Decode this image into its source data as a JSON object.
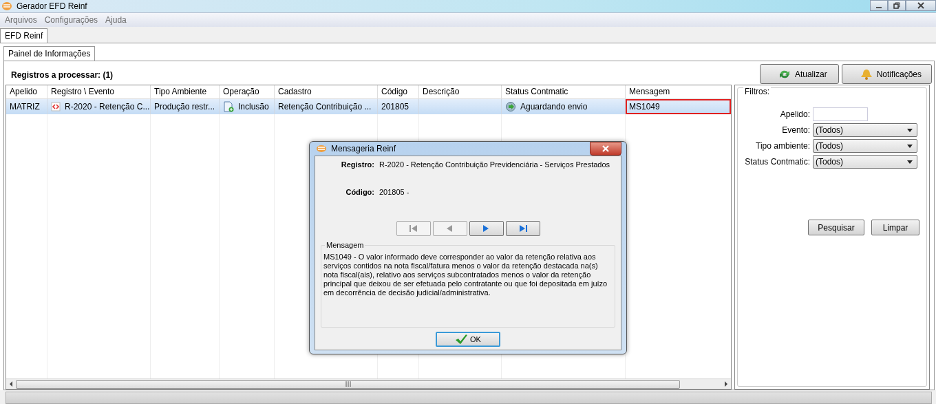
{
  "window": {
    "title": "Gerador EFD Reinf"
  },
  "menu": [
    "Arquivos",
    "Configurações",
    "Ajuda"
  ],
  "tabs": [
    {
      "label": "EFD Reinf",
      "selected": true
    }
  ],
  "subtabs": [
    {
      "label": "Painel de Informações",
      "selected": true
    }
  ],
  "summary": "Registros a processar: (1)",
  "toolbar": [
    "Atualizar",
    "Notificações"
  ],
  "table": {
    "columns": [
      "Apelido",
      "Registro \\ Evento",
      "Tipo Ambiente",
      "Operação",
      "Cadastro",
      "Código",
      "Descrição",
      "Status Contmatic",
      "Mensagem"
    ],
    "rows": [
      {
        "selected": true,
        "cells": [
          {
            "text": "MATRIZ",
            "highlighted": false
          },
          {
            "text": "R-2020 - Retenção C...",
            "highlighted": false
          },
          {
            "text": "Produção restr...",
            "highlighted": false
          },
          {
            "text": "Inclusão",
            "highlighted": false
          },
          {
            "text": "Retenção Contribuição ...",
            "highlighted": false
          },
          {
            "text": "201805",
            "highlighted": false
          },
          {
            "text": "",
            "highlighted": false
          },
          {
            "text": "Aguardando envio",
            "highlighted": false
          },
          {
            "text": "MS1049",
            "highlighted": true
          }
        ]
      }
    ]
  },
  "filters": {
    "title": "Filtros:",
    "fields": [
      {
        "kind": "text",
        "label": "Apelido:"
      },
      {
        "kind": "select",
        "label": "Evento:",
        "value": "(Todos)"
      },
      {
        "kind": "select",
        "label": "Tipo ambiente:",
        "value": "(Todos)"
      },
      {
        "kind": "select",
        "label": "Status Contmatic:",
        "value": "(Todos)"
      }
    ],
    "buttons": [
      "Pesquisar",
      "Limpar"
    ]
  },
  "dialog": {
    "title": "Mensageria Reinf",
    "fields": [
      {
        "label": "Registro:",
        "value": "R-2020 - Retenção Contribuição Previdenciária - Serviços Prestados"
      },
      {
        "label": "Código:",
        "value": "201805 -"
      }
    ],
    "nav": [
      {
        "kind": "first",
        "disabled": true
      },
      {
        "kind": "prev",
        "disabled": true
      },
      {
        "kind": "next",
        "disabled": false
      },
      {
        "kind": "last",
        "disabled": false
      }
    ],
    "message_title": "Mensagem",
    "message": "MS1049 - O valor informado deve corresponder ao valor da retenção relativa aos serviços contidos na nota fiscal/fatura menos o valor da retenção destacada na(s) nota fiscal(ais), relativo aos serviços subcontratados menos o valor da retenção principal que deixou de ser efetuada pelo contratante ou que foi depositada em juízo em decorrência de decisão judicial/administrativa.",
    "ok": "OK"
  }
}
